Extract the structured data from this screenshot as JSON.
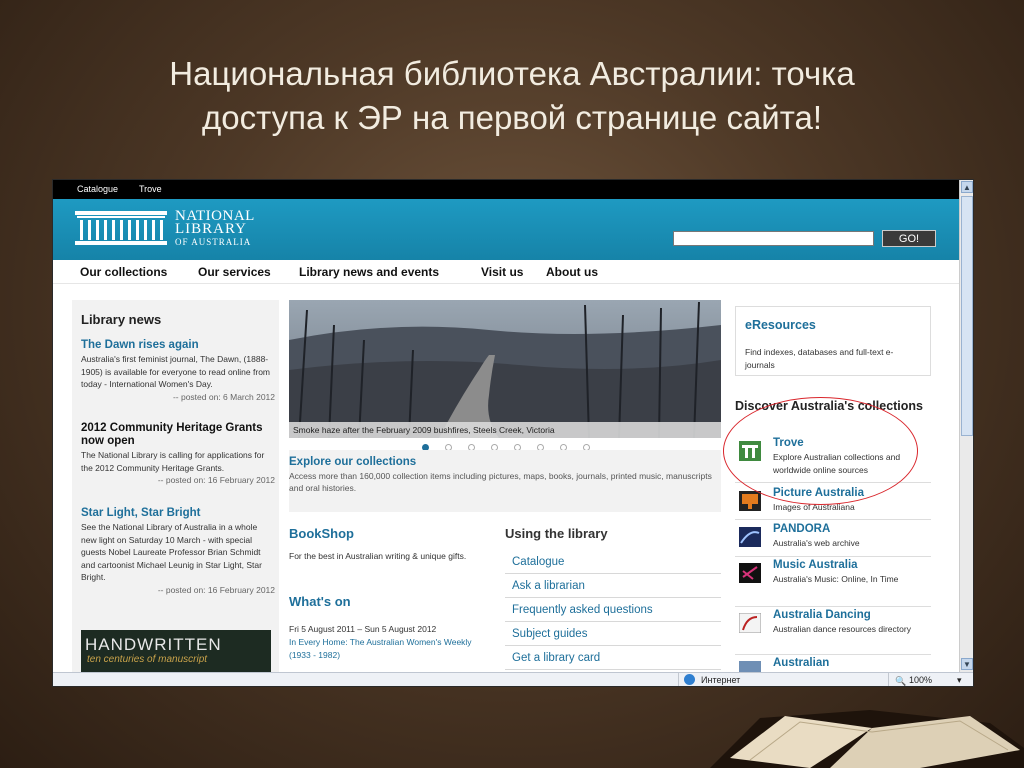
{
  "slide": {
    "title_line1": "Национальная библиотека Австралии: точка",
    "title_line2": "доступа к ЭР на первой странице сайта!"
  },
  "site": {
    "topbar": [
      "Catalogue",
      "Trove"
    ],
    "logo": {
      "line1": "NATIONAL",
      "line2": "LIBRARY",
      "line3": "OF AUSTRALIA"
    },
    "search": {
      "value": "",
      "button": "GO!"
    },
    "nav": [
      "Our collections",
      "Our services",
      "Library news and events",
      "Visit us",
      "About us"
    ],
    "library_news": {
      "heading": "Library news",
      "items": [
        {
          "title": "The Dawn rises again",
          "body": "Australia's first feminist journal, The Dawn, (1888-1905) is available for everyone to read online from today - International Women's Day.",
          "date": "-- posted on: 6 March 2012"
        },
        {
          "title": "2012 Community Heritage Grants now open",
          "body": "The National Library is calling for applications for the 2012 Community Heritage Grants.",
          "date": "-- posted on: 16 February 2012"
        },
        {
          "title": "Star Light, Star Bright",
          "body": "See the National Library of Australia in a whole new light on Saturday 10 March - with special guests Nobel Laureate Professor Brian Schmidt and cartoonist Michael Leunig in Star Light, Star Bright.",
          "date": "-- posted on: 16 February 2012"
        }
      ],
      "banner": {
        "title": "HANDWRITTEN",
        "subtitle": "ten centuries of manuscript"
      }
    },
    "hero": {
      "caption": "Smoke haze after the February 2009 bushfires, Steels Creek, Victoria",
      "slides_total": 8,
      "active_slide": 1
    },
    "explore": {
      "title": "Explore our collections",
      "body": "Access more than 160,000 collection items including pictures, maps, books, journals, printed music, manuscripts and oral histories."
    },
    "bookshop": {
      "title": "BookShop",
      "body": "For the best in Australian writing & unique gifts."
    },
    "whats_on": {
      "title": "What's on",
      "dates": "Fri 5 August 2011 – Sun 5 August 2012",
      "link": "In Every Home: The Australian Women's Weekly (1933 - 1982)"
    },
    "using": {
      "title": "Using the library",
      "items": [
        "Catalogue",
        "Ask a librarian",
        "Frequently asked questions",
        "Subject guides",
        "Get a library card"
      ]
    },
    "eresources": {
      "title": "eResources",
      "body": "Find indexes, databases and full-text e-journals"
    },
    "discover": {
      "title": "Discover Australia's collections",
      "items": [
        {
          "title": "Trove",
          "body": "Explore Australian collections and worldwide online sources",
          "icon": "trove-icon"
        },
        {
          "title": "Picture Australia",
          "body": "Images of Australiana",
          "icon": "picture-australia-icon"
        },
        {
          "title": "PANDORA",
          "body": "Australia's web archive",
          "icon": "pandora-icon"
        },
        {
          "title": "Music Australia",
          "body": "Australia's Music: Online, In Time",
          "icon": "music-australia-icon"
        },
        {
          "title": "Australia Dancing",
          "body": "Australian dance resources directory",
          "icon": "australia-dancing-icon"
        },
        {
          "title": "Australian",
          "body": "",
          "icon": "australian-icon"
        }
      ]
    },
    "statusbar": {
      "zone": "Интернет",
      "zoom": "100%"
    }
  },
  "colors": {
    "header": "#1a8fb5",
    "link": "#1e6f9a",
    "annotation_ring": "#d9262c"
  }
}
